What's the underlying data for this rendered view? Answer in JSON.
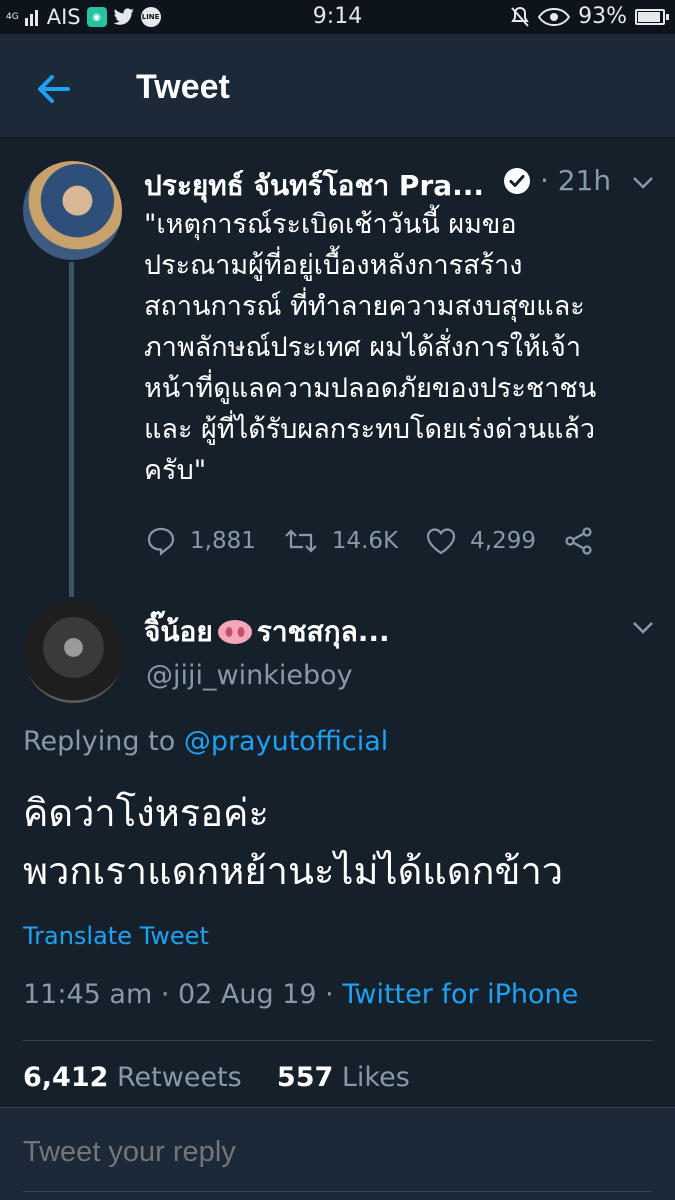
{
  "status_bar": {
    "network": "4G",
    "carrier": "AIS",
    "time": "9:14",
    "battery": "93%",
    "battery_level": 0.93,
    "icons": [
      "signal-icon",
      "app-icon",
      "twitter-icon",
      "line-icon",
      "mute-icon",
      "eye-icon",
      "battery-icon"
    ]
  },
  "header": {
    "title": "Tweet"
  },
  "parent_tweet": {
    "author": "ประยุทธ์ จันทร์โอชา Pra...",
    "time": "· 21h",
    "text": "\"เหตุการณ์ระเบิดเช้าวันนี้ ผมขอประณามผู้ที่อยู่เบื้องหลังการสร้างสถานการณ์ ที่ทำลายความสงบสุขและภาพลักษณ์ประเทศ ผมได้สั่งการให้เจ้าหน้าที่ดูแลความปลอดภัยของประชาชน และ ผู้ที่ได้รับผลกระทบโดยเร่งด่วนแล้วครับ\"",
    "lines": [
      "\"เหตุการณ์ระเบิดเช้าวันนี้ ผมขอ",
      "ประณามผู้ที่อยู่เบื้องหลังการสร้าง",
      "สถานการณ์ ที่ทำลายความสงบสุขและ",
      "ภาพลักษณ์ประเทศ ผมได้สั่งการให้เจ้า",
      "หน้าที่ดูแลความปลอดภัยของประชาชน",
      "และ ผู้ที่ได้รับผลกระทบโดยเร่งด่วนแล้ว",
      "ครับ\""
    ],
    "replies": "1,881",
    "retweets": "14.6K",
    "likes": "4,299"
  },
  "reply_tweet": {
    "author_prefix": "จิ๊น้อย",
    "author_suffix": "ราชสกุล...",
    "handle": "@jiji_winkieboy",
    "replying_label": "Replying to",
    "replying_to": "@prayutofficial",
    "line1": "คิดว่าโง่หรอค่ะ",
    "line2": "พวกเราแดกหย้านะไม่ได้แดกข้าว",
    "translate": "Translate Tweet",
    "time": "11:45 am · 02 Aug 19 ·",
    "source": "Twitter for iPhone",
    "retweet_count": "6,412",
    "retweet_label": "Retweets",
    "like_count": "557",
    "like_label": "Likes"
  },
  "reply_box": {
    "placeholder": "Tweet your reply"
  },
  "colors": {
    "background": "#15202b",
    "header": "#1c2938",
    "accent": "#1da1f2",
    "muted": "#8899a6"
  }
}
